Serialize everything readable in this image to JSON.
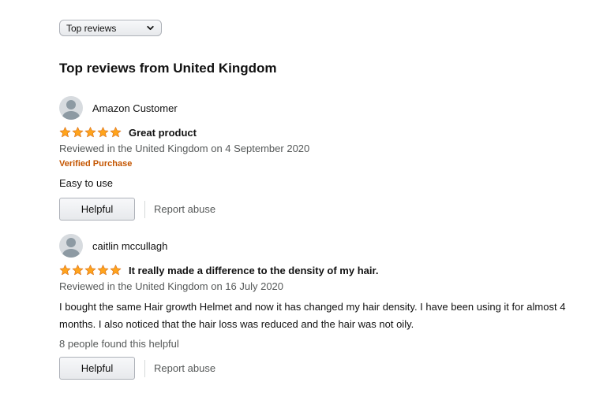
{
  "sort": {
    "selected": "Top reviews",
    "icon": "chevron-down-icon"
  },
  "section_title": "Top reviews from United Kingdom",
  "colors": {
    "star": "#ffa41c",
    "verified": "#c45500",
    "muted_text": "#565959"
  },
  "reviews": [
    {
      "author": "Amazon Customer",
      "rating": 5,
      "title": "Great product",
      "date": "Reviewed in the United Kingdom on 4 September 2020",
      "verified": "Verified Purchase",
      "body": "Easy to use",
      "helpful_label": "Helpful",
      "report_label": "Report abuse"
    },
    {
      "author": "caitlin mccullagh",
      "rating": 5,
      "title": "It really made a difference to the density of my hair.",
      "date": "Reviewed in the United Kingdom on 16 July 2020",
      "body": "I bought the same Hair growth Helmet and now it has changed my hair density. I have been using it for almost 4 months. I also noticed that the hair loss was reduced and the hair was not oily.",
      "helpful_count": "8 people found this helpful",
      "helpful_label": "Helpful",
      "report_label": "Report abuse"
    }
  ]
}
